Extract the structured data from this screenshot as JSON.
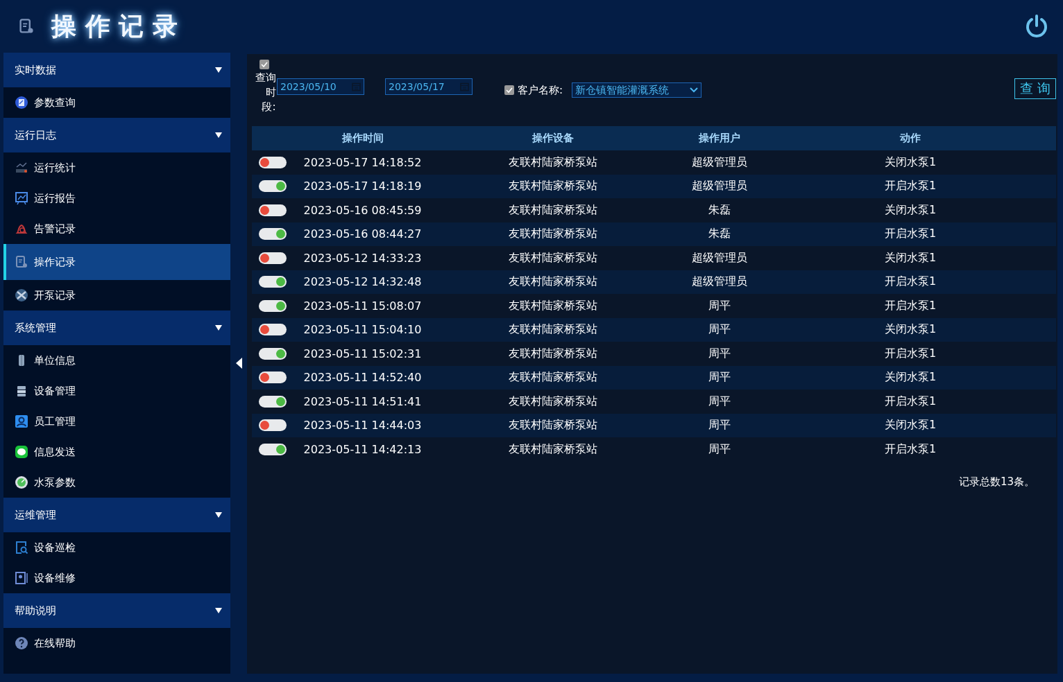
{
  "header": {
    "title": "操 作 记 录"
  },
  "sidebar": {
    "groups": [
      {
        "label": "实时数据",
        "items": [
          {
            "label": "参数查询",
            "selected": false
          }
        ]
      },
      {
        "label": "运行日志",
        "items": [
          {
            "label": "运行统计",
            "selected": false
          },
          {
            "label": "运行报告",
            "selected": false
          },
          {
            "label": "告警记录",
            "selected": false
          },
          {
            "label": "操作记录",
            "selected": true
          },
          {
            "label": "开泵记录",
            "selected": false
          }
        ]
      },
      {
        "label": "系统管理",
        "items": [
          {
            "label": "单位信息",
            "selected": false
          },
          {
            "label": "设备管理",
            "selected": false
          },
          {
            "label": "员工管理",
            "selected": false
          },
          {
            "label": "信息发送",
            "selected": false
          },
          {
            "label": "水泵参数",
            "selected": false
          }
        ]
      },
      {
        "label": "运维管理",
        "items": [
          {
            "label": "设备巡检",
            "selected": false
          },
          {
            "label": "设备维修",
            "selected": false
          }
        ]
      },
      {
        "label": "帮助说明",
        "items": [
          {
            "label": "在线帮助",
            "selected": false
          }
        ]
      }
    ]
  },
  "filter": {
    "period_checked": true,
    "period_label": "查询时段:",
    "start_date": "2023/05/10",
    "end_date": "2023/05/17",
    "customer_checked": true,
    "customer_label": "客户名称:",
    "customer": "新仓镇智能灌溉系统",
    "query_button": "查 询"
  },
  "table": {
    "columns": [
      "操作时间",
      "操作设备",
      "操作用户",
      "动作"
    ],
    "rows": [
      {
        "on": false,
        "time": "2023-05-17 14:18:52",
        "device": "友联村陆家桥泵站",
        "user": "超级管理员",
        "action": "关闭水泵1"
      },
      {
        "on": true,
        "time": "2023-05-17 14:18:19",
        "device": "友联村陆家桥泵站",
        "user": "超级管理员",
        "action": "开启水泵1"
      },
      {
        "on": false,
        "time": "2023-05-16 08:45:59",
        "device": "友联村陆家桥泵站",
        "user": "朱磊",
        "action": "关闭水泵1"
      },
      {
        "on": true,
        "time": "2023-05-16 08:44:27",
        "device": "友联村陆家桥泵站",
        "user": "朱磊",
        "action": "开启水泵1"
      },
      {
        "on": false,
        "time": "2023-05-12 14:33:23",
        "device": "友联村陆家桥泵站",
        "user": "超级管理员",
        "action": "关闭水泵1"
      },
      {
        "on": true,
        "time": "2023-05-12 14:32:48",
        "device": "友联村陆家桥泵站",
        "user": "超级管理员",
        "action": "开启水泵1"
      },
      {
        "on": true,
        "time": "2023-05-11 15:08:07",
        "device": "友联村陆家桥泵站",
        "user": "周平",
        "action": "开启水泵1"
      },
      {
        "on": false,
        "time": "2023-05-11 15:04:10",
        "device": "友联村陆家桥泵站",
        "user": "周平",
        "action": "关闭水泵1"
      },
      {
        "on": true,
        "time": "2023-05-11 15:02:31",
        "device": "友联村陆家桥泵站",
        "user": "周平",
        "action": "开启水泵1"
      },
      {
        "on": false,
        "time": "2023-05-11 14:52:40",
        "device": "友联村陆家桥泵站",
        "user": "周平",
        "action": "关闭水泵1"
      },
      {
        "on": true,
        "time": "2023-05-11 14:51:41",
        "device": "友联村陆家桥泵站",
        "user": "周平",
        "action": "开启水泵1"
      },
      {
        "on": false,
        "time": "2023-05-11 14:44:03",
        "device": "友联村陆家桥泵站",
        "user": "周平",
        "action": "关闭水泵1"
      },
      {
        "on": true,
        "time": "2023-05-11 14:42:13",
        "device": "友联村陆家桥泵站",
        "user": "周平",
        "action": "开启水泵1"
      }
    ],
    "footer": "记录总数13条。"
  }
}
